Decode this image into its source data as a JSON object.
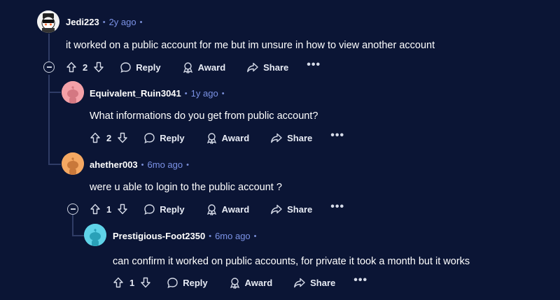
{
  "comments": [
    {
      "username": "Jedi223",
      "time": "2y ago",
      "body": "it worked on a public account for me but im unsure in how to view another account",
      "votes": "2",
      "reply_label": "Reply",
      "award_label": "Award",
      "share_label": "Share",
      "more_label": "•••",
      "avatar_color": "#f5f5f5"
    },
    {
      "username": "Equivalent_Ruin3041",
      "time": "1y ago",
      "body": "What informations do you get from public account?",
      "votes": "2",
      "reply_label": "Reply",
      "award_label": "Award",
      "share_label": "Share",
      "more_label": "•••",
      "avatar_color": "#f4a1a8"
    },
    {
      "username": "ahether003",
      "time": "6mo ago",
      "body": "were u able to login to the public account ?",
      "votes": "1",
      "reply_label": "Reply",
      "award_label": "Award",
      "share_label": "Share",
      "more_label": "•••",
      "avatar_color": "#f5a862"
    },
    {
      "username": "Prestigious-Foot2350",
      "time": "6mo ago",
      "body": "can confirm it worked on public accounts, for private it took a month but it works",
      "votes": "1",
      "reply_label": "Reply",
      "award_label": "Award",
      "share_label": "Share",
      "more_label": "•••",
      "avatar_color": "#5fd3e8"
    }
  ],
  "dot": "•",
  "icons": {
    "upvote": "upvote-icon",
    "downvote": "downvote-icon",
    "reply": "reply-bubble-icon",
    "award": "award-icon",
    "share": "share-arrow-icon",
    "collapse": "collapse-minus-icon"
  }
}
